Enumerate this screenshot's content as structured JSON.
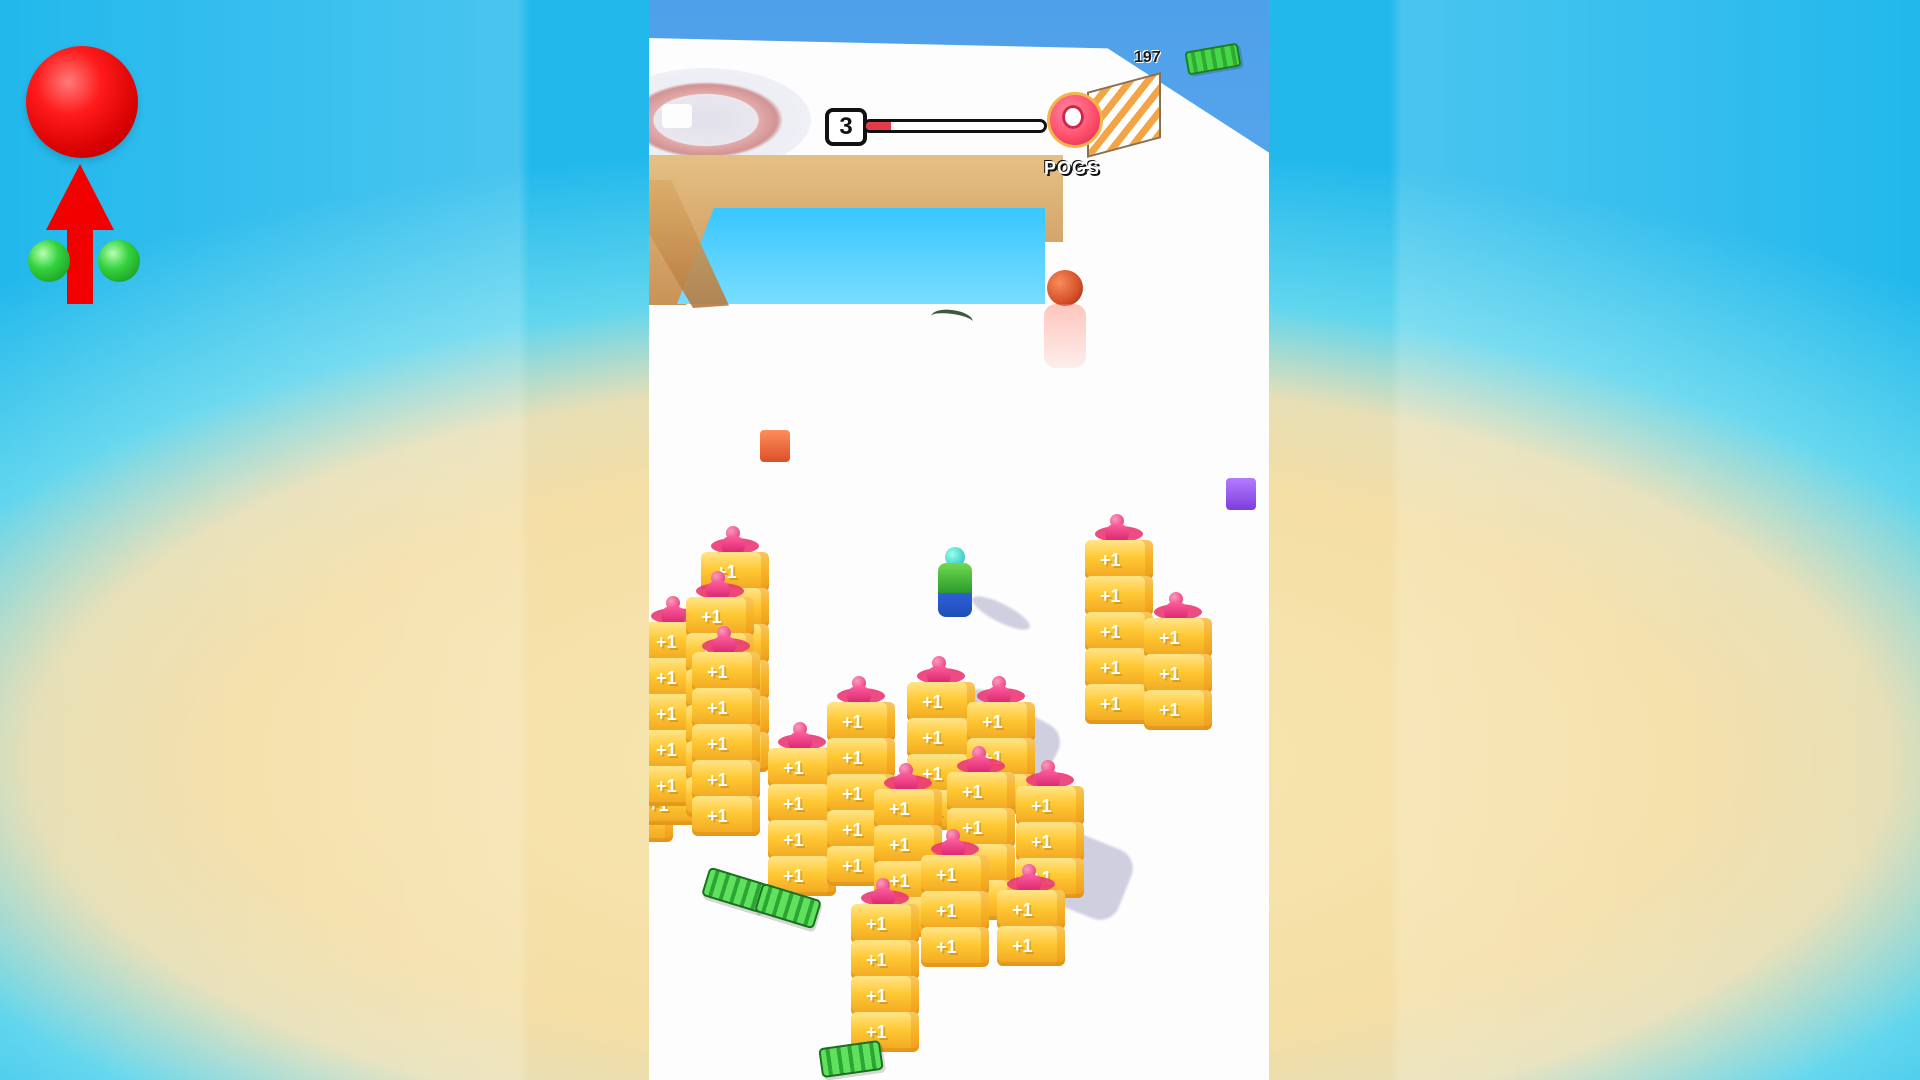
{
  "hud": {
    "cash_count": "197",
    "level_number": "3",
    "boss_name": "POGS",
    "level_progress_percent": 14
  },
  "icons": {
    "top_left": "red-ball-arrow-indicator",
    "cash": "cash-icon",
    "boss": "boss-badge-icon"
  },
  "colors": {
    "ocean": "#22b8ec",
    "sand": "#f4dea4",
    "snow": "#fdfdfd",
    "block_yellow": "#ffc833",
    "enemy_pink": "#e12f74",
    "cash_green": "#47d84a",
    "progress_red": "#e23b4b"
  }
}
